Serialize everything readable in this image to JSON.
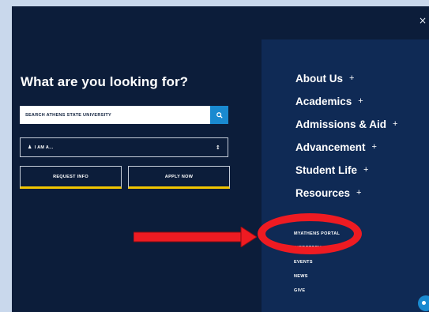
{
  "close_label": "×",
  "heading": "What are you looking for?",
  "search": {
    "placeholder": "SEARCH ATHENS STATE UNIVERSITY"
  },
  "i_am": {
    "label": "I AM A...",
    "person_glyph": "♟",
    "caret": "↕"
  },
  "buttons": {
    "request_info": "REQUEST INFO",
    "apply_now": "APPLY NOW"
  },
  "nav": [
    {
      "label": "About Us",
      "plus": "+"
    },
    {
      "label": "Academics",
      "plus": "+"
    },
    {
      "label": "Admissions & Aid",
      "plus": "+"
    },
    {
      "label": "Advancement",
      "plus": "+"
    },
    {
      "label": "Student Life",
      "plus": "+"
    },
    {
      "label": "Resources",
      "plus": "+"
    }
  ],
  "quick_links": [
    "MYATHENS PORTAL",
    "DIRECTORY",
    "EVENTS",
    "NEWS",
    "GIVE"
  ],
  "colors": {
    "page_bg": "#c9d8ec",
    "overlay_bg": "#0c1d3a",
    "panel_bg": "#0f2a55",
    "accent_blue": "#1a8ad0",
    "button_underline": "#f2c500",
    "annotation_red": "#ee1b22"
  },
  "icons": {
    "search_button": "search-icon",
    "close": "close-icon",
    "chat": "chat-icon"
  }
}
